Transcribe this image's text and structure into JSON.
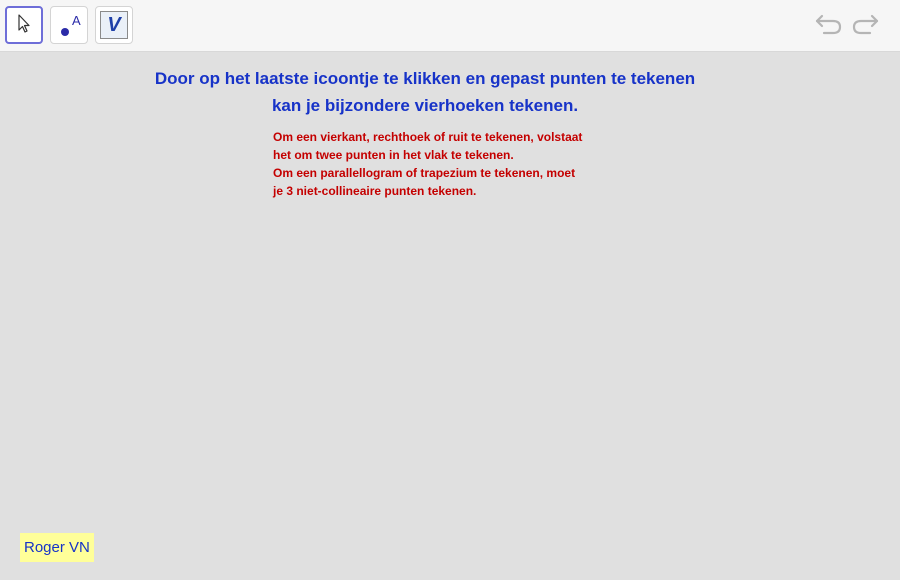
{
  "toolbar": {
    "tools": [
      {
        "name": "move-tool",
        "icon": "arrow-cursor-icon",
        "active": true
      },
      {
        "name": "point-tool",
        "icon": "point-icon",
        "label": "A"
      },
      {
        "name": "custom-tool",
        "icon": "custom-v-icon",
        "label": "V"
      }
    ],
    "undo_icon": "undo-icon",
    "redo_icon": "redo-icon"
  },
  "canvas": {
    "title_lines": [
      "Door op het laatste icoontje te klikken en gepast punten te tekenen",
      "kan je bijzondere vierhoeken tekenen."
    ],
    "note_lines": [
      "Om een vierkant, rechthoek of ruit te tekenen, volstaat",
      "het om twee punten in het vlak te tekenen.",
      "Om een parallellogram of trapezium te tekenen, moet",
      "je 3 niet-collineaire punten tekenen."
    ],
    "author": "Roger VN"
  },
  "colors": {
    "title": "#1733c8",
    "note": "#c40000",
    "author_bg": "#ffff99",
    "active_tool_border": "#6e6ed8"
  }
}
